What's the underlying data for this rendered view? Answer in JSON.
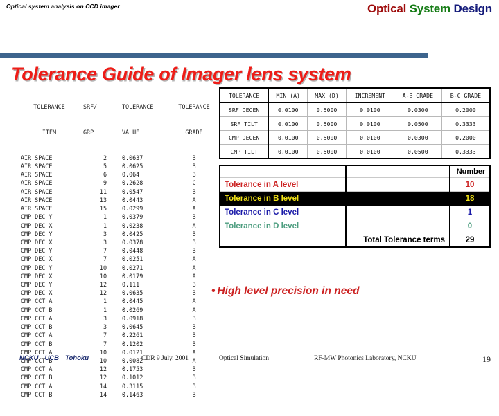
{
  "header": {
    "corner_note": "Optical system analysis on CCD imager",
    "title_part1": "Optical",
    "title_part2": "System",
    "title_part3": "Design",
    "color_part1": "#9e0b0b",
    "color_part2": "#167c16",
    "color_part3": "#131a7a",
    "rule_color": "#3d648d"
  },
  "main_title": "Tolerance Guide of Imager lens system",
  "main_title_color": "#ee1c17",
  "tolerance_list": {
    "headers_line1": [
      "TOLERANCE",
      "SRF/",
      "TOLERANCE",
      "TOLERANCE"
    ],
    "headers_line2": [
      "ITEM",
      "GRP",
      "VALUE",
      "GRADE"
    ],
    "rows": [
      {
        "item": "AIR SPACE",
        "grp": "2",
        "value": "0.0637",
        "grade": "B"
      },
      {
        "item": "AIR SPACE",
        "grp": "5",
        "value": "0.0625",
        "grade": "B"
      },
      {
        "item": "AIR SPACE",
        "grp": "6",
        "value": "0.064",
        "grade": "B"
      },
      {
        "item": "AIR SPACE",
        "grp": "9",
        "value": "0.2628",
        "grade": "C"
      },
      {
        "item": "AIR SPACE",
        "grp": "11",
        "value": "0.0547",
        "grade": "B"
      },
      {
        "item": "AIR SPACE",
        "grp": "13",
        "value": "0.0443",
        "grade": "A"
      },
      {
        "item": "AIR SPACE",
        "grp": "15",
        "value": "0.0299",
        "grade": "A"
      },
      {
        "item": "CMP DEC Y",
        "grp": "1",
        "value": "0.0379",
        "grade": "B"
      },
      {
        "item": "CMP DEC X",
        "grp": "1",
        "value": "0.0238",
        "grade": "A"
      },
      {
        "item": "CMP DEC Y",
        "grp": "3",
        "value": "0.0425",
        "grade": "B"
      },
      {
        "item": "CMP DEC X",
        "grp": "3",
        "value": "0.0378",
        "grade": "B"
      },
      {
        "item": "CMP DEC Y",
        "grp": "7",
        "value": "0.0448",
        "grade": "B"
      },
      {
        "item": "CMP DEC X",
        "grp": "7",
        "value": "0.0251",
        "grade": "A"
      },
      {
        "item": "CMP DEC Y",
        "grp": "10",
        "value": "0.0271",
        "grade": "A"
      },
      {
        "item": "CMP DEC X",
        "grp": "10",
        "value": "0.0179",
        "grade": "A"
      },
      {
        "item": "CMP DEC Y",
        "grp": "12",
        "value": "0.111",
        "grade": "B"
      },
      {
        "item": "CMP DEC X",
        "grp": "12",
        "value": "0.0635",
        "grade": "B"
      },
      {
        "item": "CMP CCT A",
        "grp": "1",
        "value": "0.0445",
        "grade": "A"
      },
      {
        "item": "CMP CCT B",
        "grp": "1",
        "value": "0.0269",
        "grade": "A"
      },
      {
        "item": "CMP CCT A",
        "grp": "3",
        "value": "0.0918",
        "grade": "B"
      },
      {
        "item": "CMP CCT B",
        "grp": "3",
        "value": "0.0645",
        "grade": "B"
      },
      {
        "item": "CMP CCT A",
        "grp": "7",
        "value": "0.2261",
        "grade": "B"
      },
      {
        "item": "CMP CCT B",
        "grp": "7",
        "value": "0.1202",
        "grade": "B"
      },
      {
        "item": "CMP CCT A",
        "grp": "10",
        "value": "0.0121",
        "grade": "A"
      },
      {
        "item": "CMP CCT B",
        "grp": "10",
        "value": "0.0082",
        "grade": "A"
      },
      {
        "item": "CMP CCT A",
        "grp": "12",
        "value": "0.1753",
        "grade": "B"
      },
      {
        "item": "CMP CCT B",
        "grp": "12",
        "value": "0.1012",
        "grade": "B"
      },
      {
        "item": "CMP CCT A",
        "grp": "14",
        "value": "0.3115",
        "grade": "B"
      },
      {
        "item": "CMP CCT B",
        "grp": "14",
        "value": "0.1463",
        "grade": "B"
      }
    ]
  },
  "grade_table": {
    "headers": [
      "TOLERANCE",
      "MIN (A)",
      "MAX (D)",
      "INCREMENT",
      "A-B GRADE",
      "B-C GRADE"
    ],
    "rows": [
      [
        "SRF DECEN",
        "0.0100",
        "0.5000",
        "0.0100",
        "0.0300",
        "0.2000"
      ],
      [
        "SRF TILT",
        "0.0100",
        "0.5000",
        "0.0100",
        "0.0500",
        "0.3333"
      ],
      [
        "CMP DECEN",
        "0.0100",
        "0.5000",
        "0.0100",
        "0.0300",
        "0.2000"
      ],
      [
        "CMP TILT",
        "0.0100",
        "0.5000",
        "0.0100",
        "0.0500",
        "0.3333"
      ]
    ]
  },
  "level_summary": {
    "number_header": "Number",
    "levels": [
      {
        "label": "Tolerance in A level",
        "count": "10",
        "color": "#cc2222"
      },
      {
        "label": "Tolerance in B level",
        "count": "18",
        "color": "#f2e316"
      },
      {
        "label": "Tolerance in C level",
        "count": "1",
        "color": "#1a1aa8"
      },
      {
        "label": "Tolerance in D level",
        "count": "0",
        "color": "#4e9e80"
      }
    ],
    "total_label": "Total Tolerance terms",
    "total_count": "29"
  },
  "bullet": {
    "marker": "•",
    "text": "High level precision in need"
  },
  "footer": {
    "org1": "NCKU",
    "org2": "UCB",
    "org3": "Tohoku",
    "cdr": "CDR  9 July, 2001",
    "simulation": "Optical Simulation",
    "lab": "RF-MW Photonics Laboratory,  NCKU",
    "page": "19"
  }
}
